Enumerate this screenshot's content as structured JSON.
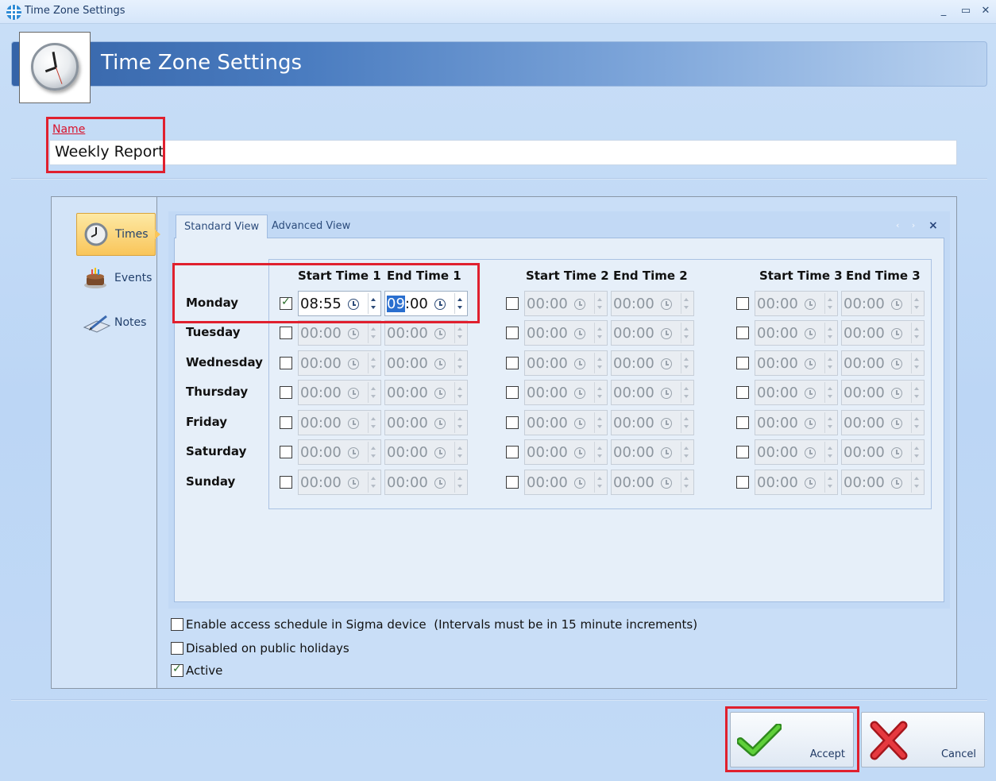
{
  "window": {
    "title": "Time Zone Settings",
    "minimize": "_",
    "maximize": "▭",
    "close": "✕"
  },
  "header": {
    "title": "Time Zone Settings"
  },
  "name_field": {
    "label": "Name",
    "value": "Weekly Report"
  },
  "nav": {
    "times": "Times",
    "events": "Events",
    "notes": "Notes"
  },
  "tabs": {
    "standard": "Standard View",
    "advanced": "Advanced View",
    "close": "×"
  },
  "columns": {
    "start1": "Start Time 1",
    "end1": "End Time 1",
    "start2": "Start Time 2",
    "end2": "End Time 2",
    "start3": "Start Time 3",
    "end3": "End Time 3"
  },
  "schedule": [
    {
      "day": "Monday",
      "slots": [
        {
          "enabled": true,
          "start": "08:55",
          "end_hl": "09",
          "end_rest": ":00"
        },
        {
          "enabled": false,
          "start": "00:00",
          "end": "00:00"
        },
        {
          "enabled": false,
          "start": "00:00",
          "end": "00:00"
        }
      ]
    },
    {
      "day": "Tuesday",
      "slots": [
        {
          "enabled": false,
          "start": "00:00",
          "end": "00:00"
        },
        {
          "enabled": false,
          "start": "00:00",
          "end": "00:00"
        },
        {
          "enabled": false,
          "start": "00:00",
          "end": "00:00"
        }
      ]
    },
    {
      "day": "Wednesday",
      "slots": [
        {
          "enabled": false,
          "start": "00:00",
          "end": "00:00"
        },
        {
          "enabled": false,
          "start": "00:00",
          "end": "00:00"
        },
        {
          "enabled": false,
          "start": "00:00",
          "end": "00:00"
        }
      ]
    },
    {
      "day": "Thursday",
      "slots": [
        {
          "enabled": false,
          "start": "00:00",
          "end": "00:00"
        },
        {
          "enabled": false,
          "start": "00:00",
          "end": "00:00"
        },
        {
          "enabled": false,
          "start": "00:00",
          "end": "00:00"
        }
      ]
    },
    {
      "day": "Friday",
      "slots": [
        {
          "enabled": false,
          "start": "00:00",
          "end": "00:00"
        },
        {
          "enabled": false,
          "start": "00:00",
          "end": "00:00"
        },
        {
          "enabled": false,
          "start": "00:00",
          "end": "00:00"
        }
      ]
    },
    {
      "day": "Saturday",
      "slots": [
        {
          "enabled": false,
          "start": "00:00",
          "end": "00:00"
        },
        {
          "enabled": false,
          "start": "00:00",
          "end": "00:00"
        },
        {
          "enabled": false,
          "start": "00:00",
          "end": "00:00"
        }
      ]
    },
    {
      "day": "Sunday",
      "slots": [
        {
          "enabled": false,
          "start": "00:00",
          "end": "00:00"
        },
        {
          "enabled": false,
          "start": "00:00",
          "end": "00:00"
        },
        {
          "enabled": false,
          "start": "00:00",
          "end": "00:00"
        }
      ]
    }
  ],
  "options": {
    "sigma": {
      "label": "Enable access schedule in Sigma device",
      "note": "(Intervals must be in 15 minute increments)",
      "checked": false
    },
    "holidays": {
      "label": "Disabled on public holidays",
      "checked": false
    },
    "active": {
      "label": "Active",
      "checked": true
    }
  },
  "buttons": {
    "accept": "Accept",
    "cancel": "Cancel"
  },
  "icons": {
    "app": "grid-globe-icon",
    "header": "clock-icon",
    "times": "clock-icon",
    "events": "cake-icon",
    "notes": "notebook-pen-icon",
    "time_field": "clock-icon",
    "accept": "check-icon",
    "cancel": "x-icon"
  },
  "colors": {
    "annotation_red": "#e0202e",
    "header_blue": "#3564a8",
    "accept_green": "#3fae27",
    "cancel_red": "#d9242a"
  }
}
